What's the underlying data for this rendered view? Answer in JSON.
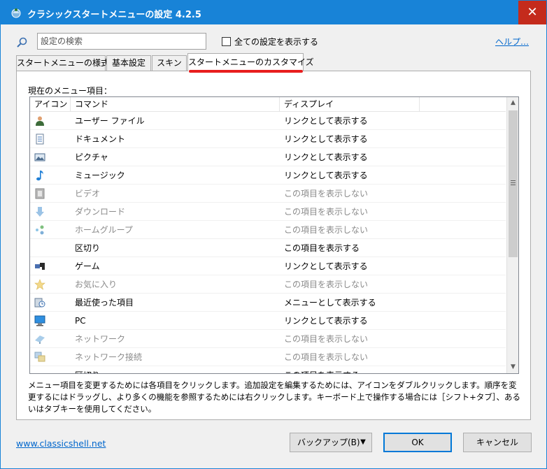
{
  "window": {
    "title": "クラシックスタートメニューの設定 4.2.5",
    "close_glyph": "✕"
  },
  "search": {
    "placeholder": "設定の検索",
    "value": ""
  },
  "show_all": {
    "label": "全ての設定を表示する",
    "checked": false
  },
  "help_link": "ヘルプ…",
  "tabs": [
    {
      "label": "スタートメニューの様式",
      "active": false
    },
    {
      "label": "基本設定",
      "active": false
    },
    {
      "label": "スキン",
      "active": false
    },
    {
      "label": "スタートメニューのカスタマイズ",
      "active": true
    }
  ],
  "list": {
    "label": "現在のメニュー項目：",
    "columns": [
      "アイコン",
      "コマンド",
      "ディスプレイ"
    ],
    "rows": [
      {
        "icon": "user-files-icon",
        "command": "ユーザー ファイル",
        "display": "リンクとして表示する",
        "dim": false
      },
      {
        "icon": "documents-icon",
        "command": "ドキュメント",
        "display": "リンクとして表示する",
        "dim": false
      },
      {
        "icon": "pictures-icon",
        "command": "ピクチャ",
        "display": "リンクとして表示する",
        "dim": false
      },
      {
        "icon": "music-icon",
        "command": "ミュージック",
        "display": "リンクとして表示する",
        "dim": false
      },
      {
        "icon": "videos-icon",
        "command": "ビデオ",
        "display": "この項目を表示しない",
        "dim": true
      },
      {
        "icon": "downloads-icon",
        "command": "ダウンロード",
        "display": "この項目を表示しない",
        "dim": true
      },
      {
        "icon": "homegroup-icon",
        "command": "ホームグループ",
        "display": "この項目を表示しない",
        "dim": true
      },
      {
        "icon": "",
        "command": "区切り",
        "display": "この項目を表示する",
        "dim": false
      },
      {
        "icon": "games-icon",
        "command": "ゲーム",
        "display": "リンクとして表示する",
        "dim": false
      },
      {
        "icon": "favorites-icon",
        "command": "お気に入り",
        "display": "この項目を表示しない",
        "dim": true
      },
      {
        "icon": "recent-items-icon",
        "command": "最近使った項目",
        "display": "メニューとして表示する",
        "dim": false
      },
      {
        "icon": "computer-icon",
        "command": "PC",
        "display": "リンクとして表示する",
        "dim": false
      },
      {
        "icon": "network-icon",
        "command": "ネットワーク",
        "display": "この項目を表示しない",
        "dim": true
      },
      {
        "icon": "network-connections-icon",
        "command": "ネットワーク接続",
        "display": "この項目を表示しない",
        "dim": true
      },
      {
        "icon": "",
        "command": "区切り",
        "display": "この項目を表示する",
        "dim": false
      }
    ]
  },
  "description": "メニュー項目を変更するためには各項目をクリックします。追加設定を編集するためには、アイコンをダブルクリックします。順序を変更するにはドラッグし、より多くの機能を参照するためには右クリックします。キーボード上で操作する場合には［シフト+タブ］、あるいはタブキーを使用してください。",
  "footer": {
    "site_link": "www.classicshell.net",
    "backup_label": "バックアップ(B)",
    "ok_label": "OK",
    "cancel_label": "キャンセル"
  },
  "colors": {
    "titlebar": "#1883d7",
    "close": "#c42b1c",
    "tab_highlight": "#e81e1e",
    "link": "#0066cc"
  }
}
